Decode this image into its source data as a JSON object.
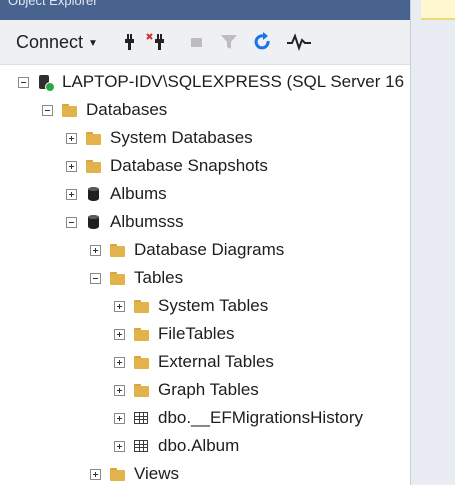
{
  "titlebar": {
    "text": "Object Explorer"
  },
  "toolbar": {
    "connect_label": "Connect",
    "icons": [
      "connect-icon",
      "disconnect-icon",
      "stop-icon",
      "filter-icon",
      "refresh-icon",
      "activity-monitor-icon"
    ]
  },
  "tree": {
    "server": "LAPTOP-IDV\\SQLEXPRESS (SQL Server 16",
    "databases": "Databases",
    "system_databases": "System Databases",
    "database_snapshots": "Database Snapshots",
    "albums": "Albums",
    "albumsss": "Albumsss",
    "database_diagrams": "Database Diagrams",
    "tables": "Tables",
    "system_tables": "System Tables",
    "file_tables": "FileTables",
    "external_tables": "External Tables",
    "graph_tables": "Graph Tables",
    "ef_history": "dbo.__EFMigrationsHistory",
    "album_table": "dbo.Album",
    "views": "Views"
  }
}
